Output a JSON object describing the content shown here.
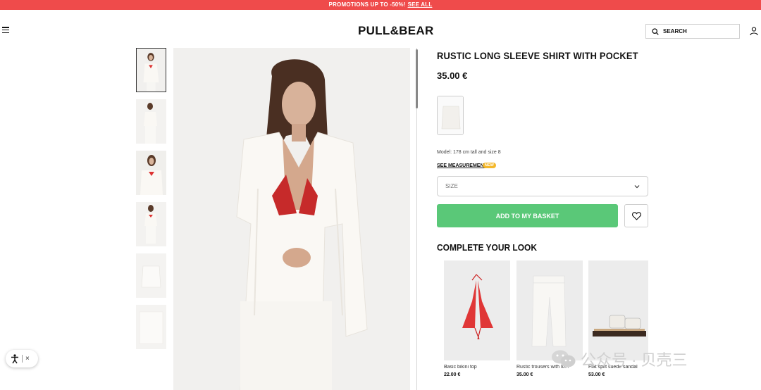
{
  "promo": {
    "text": "PROMOTIONS UP TO -50%!",
    "link": "SEE ALL"
  },
  "header": {
    "logo": "PULL&BEAR",
    "search_label": "SEARCH"
  },
  "product": {
    "title": "RUSTIC LONG SLEEVE SHIRT WITH POCKET",
    "price": "35.00 €",
    "model_info": "Model: 178 cm tall and size 8",
    "measurements_link": "SEE MEASUREMENTS",
    "new_badge": "NEW",
    "size_placeholder": "SIZE",
    "add_button": "ADD TO MY BASKET"
  },
  "complete_look": {
    "title": "COMPLETE YOUR LOOK",
    "items": [
      {
        "name": "Basic bikini top",
        "price": "22.00 €"
      },
      {
        "name": "Rustic trousers with lo...",
        "price": "35.00 €"
      },
      {
        "name": "Flat split suede sandal",
        "price": "53.00 €"
      }
    ]
  },
  "watermark": {
    "text": "公众号 · 贝壳三"
  },
  "colors": {
    "promo_bg": "#ef4b4b",
    "add_button": "#5ac878",
    "badge": "#f4b82b"
  },
  "icons": [
    "menu-icon",
    "search-icon",
    "user-icon",
    "chevron-down-icon",
    "heart-icon",
    "accessibility-icon",
    "close-icon"
  ]
}
